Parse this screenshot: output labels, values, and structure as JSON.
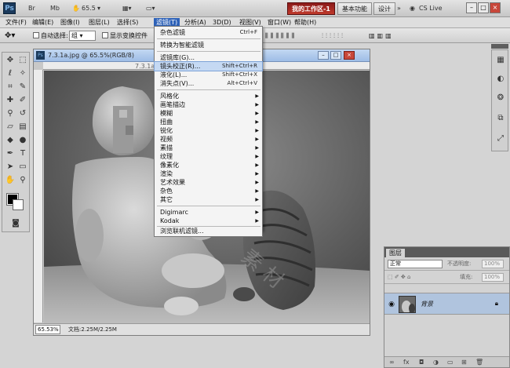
{
  "appbar": {
    "logo": "Ps",
    "zoom": "65.5",
    "workspace_buttons": [
      "我的工作区-1",
      "基本功能",
      "设计"
    ],
    "cs_live": "CS Live"
  },
  "menubar": {
    "items": [
      "文件(F)",
      "编辑(E)",
      "图像(I)",
      "图层(L)",
      "选择(S)",
      "滤镜(T)",
      "分析(A)",
      "3D(D)",
      "视图(V)",
      "窗口(W)",
      "帮助(H)"
    ]
  },
  "options": {
    "auto_select_label": "自动选择:",
    "auto_select_value": "组",
    "show_transform_label": "显示变换控件"
  },
  "document": {
    "title": "7.3.1a.jpg @ 65.5%(RGB/8)",
    "tab2_title": "7.3.1a",
    "zoom": "65.53%",
    "doc_info": "文档:2.25M/2.25M"
  },
  "filter_menu": {
    "items": [
      {
        "label": "杂色滤镜",
        "shortcut": "Ctrl+F"
      },
      {
        "label": "转换为智能滤镜"
      },
      {
        "label": "滤镜库(G)..."
      },
      {
        "label": "镜头校正(R)...",
        "shortcut": "Shift+Ctrl+R",
        "highlighted": true
      },
      {
        "label": "液化(L)...",
        "shortcut": "Shift+Ctrl+X"
      },
      {
        "label": "消失点(V)...",
        "shortcut": "Alt+Ctrl+V"
      },
      {
        "label": "风格化",
        "submenu": true
      },
      {
        "label": "画笔描边",
        "submenu": true
      },
      {
        "label": "模糊",
        "submenu": true
      },
      {
        "label": "扭曲",
        "submenu": true
      },
      {
        "label": "锐化",
        "submenu": true
      },
      {
        "label": "视频",
        "submenu": true
      },
      {
        "label": "素描",
        "submenu": true
      },
      {
        "label": "纹理",
        "submenu": true
      },
      {
        "label": "像素化",
        "submenu": true
      },
      {
        "label": "渲染",
        "submenu": true
      },
      {
        "label": "艺术效果",
        "submenu": true
      },
      {
        "label": "杂色",
        "submenu": true
      },
      {
        "label": "其它",
        "submenu": true
      },
      {
        "label": "Digimarc",
        "submenu": true
      },
      {
        "label": "Kodak",
        "submenu": true
      },
      {
        "label": "浏览联机滤镜..."
      }
    ]
  },
  "layers_panel": {
    "tab": "图层",
    "blend_mode": "正常",
    "opacity_label": "不透明度:",
    "opacity_value": "100%",
    "fill_label": "填充:",
    "fill_value": "100%",
    "layer_name": "背景"
  }
}
